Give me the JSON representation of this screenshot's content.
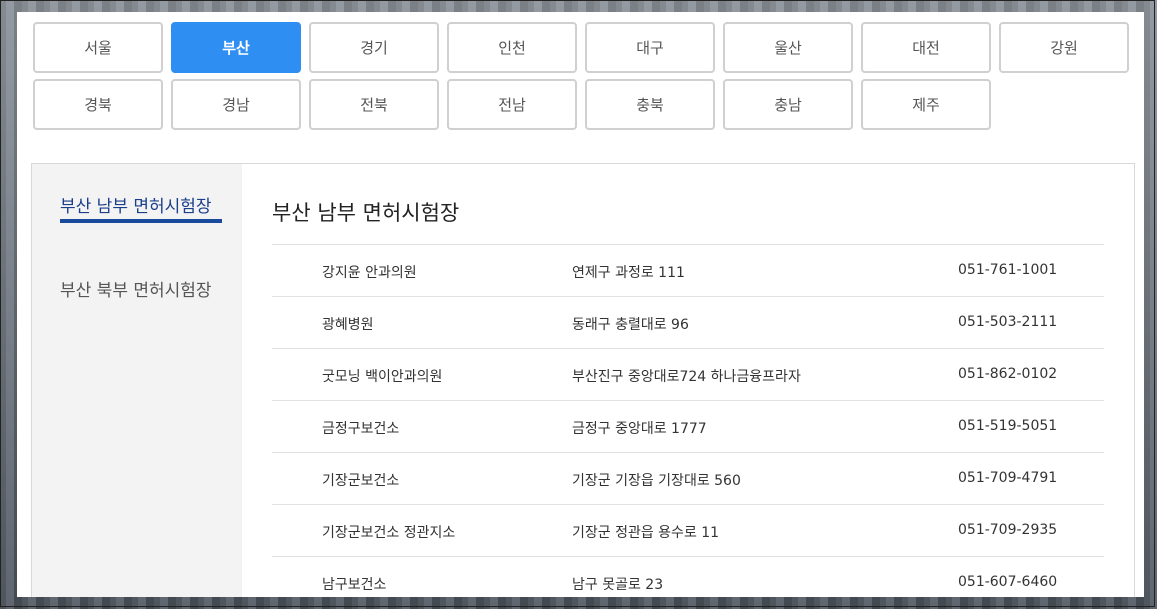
{
  "regions": {
    "row1": [
      "서울",
      "부산",
      "경기",
      "인천",
      "대구",
      "울산",
      "대전",
      "강원"
    ],
    "row2": [
      "경북",
      "경남",
      "전북",
      "전남",
      "충북",
      "충남",
      "제주"
    ],
    "active": "부산"
  },
  "sidebar": {
    "items": [
      {
        "label": "부산 남부 면허시험장",
        "active": true
      },
      {
        "label": "부산 북부 면허시험장",
        "active": false
      }
    ]
  },
  "main": {
    "title": "부산 남부 면허시험장",
    "rows": [
      {
        "name": "강지윤 안과의원",
        "address": "연제구 과정로 111",
        "phone": "051-761-1001"
      },
      {
        "name": "광혜병원",
        "address": "동래구 충렬대로 96",
        "phone": "051-503-2111"
      },
      {
        "name": "굿모닝 백이안과의원",
        "address": "부산진구 중앙대로724 하나금융프라자",
        "phone": "051-862-0102"
      },
      {
        "name": "금정구보건소",
        "address": "금정구 중앙대로 1777",
        "phone": "051-519-5051"
      },
      {
        "name": "기장군보건소",
        "address": "기장군 기장읍 기장대로 560",
        "phone": "051-709-4791"
      },
      {
        "name": "기장군보건소 정관지소",
        "address": "기장군 정관읍 용수로 11",
        "phone": "051-709-2935"
      },
      {
        "name": "남구보건소",
        "address": "남구 못골로 23",
        "phone": "051-607-6460"
      }
    ]
  },
  "colors": {
    "accent": "#2f8ef2",
    "sidebar_active": "#1a3e8c"
  }
}
